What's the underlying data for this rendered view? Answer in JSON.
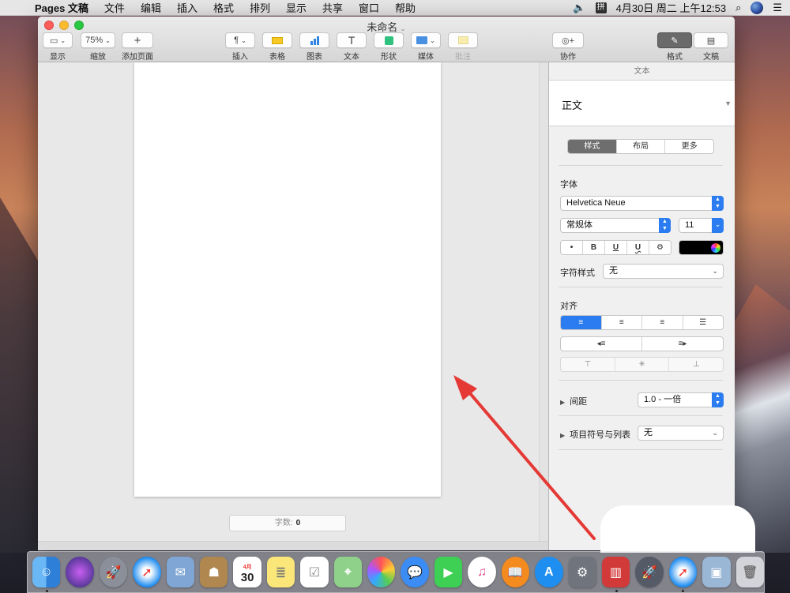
{
  "menubar": {
    "app_name": "Pages 文稿",
    "menus": [
      "文件",
      "编辑",
      "插入",
      "格式",
      "排列",
      "显示",
      "共享",
      "窗口",
      "帮助"
    ],
    "clock": "4月30日 周二 上午12:53",
    "input_method": "拼"
  },
  "window": {
    "title": "未命名",
    "toolbar": {
      "view_label": "显示",
      "zoom_value": "75%",
      "zoom_label": "缩放",
      "add_page_label": "添加页面",
      "insert_label": "插入",
      "table_label": "表格",
      "chart_label": "图表",
      "text_label": "文本",
      "shape_label": "形状",
      "media_label": "媒体",
      "comment_label": "批注",
      "collaborate_label": "协作",
      "format_label": "格式",
      "document_label": "文稿"
    }
  },
  "document": {
    "word_count_label": "字数:",
    "word_count_value": "0"
  },
  "sidebar": {
    "header": "文本",
    "paragraph_style": "正文",
    "tabs": [
      "样式",
      "布局",
      "更多"
    ],
    "font_section": "字体",
    "font_name": "Helvetica Neue",
    "font_style": "常规体",
    "font_size": "11",
    "format_buttons": [
      "•",
      "B",
      "U",
      "U",
      "⚙"
    ],
    "text_color": "#000000",
    "char_style_label": "字符样式",
    "char_style_value": "无",
    "align_section": "对齐",
    "spacing_label": "间距",
    "spacing_value": "1.0 - 一倍",
    "bullets_label": "项目符号与列表",
    "bullets_value": "无"
  },
  "dock": {
    "apps": [
      "finder",
      "siri",
      "launchpad",
      "safari",
      "mail",
      "contacts",
      "calendar",
      "notes",
      "reminders",
      "maps",
      "photos",
      "messages",
      "facetime",
      "itunes",
      "ibooks",
      "app-store",
      "system-preferences",
      "parallels",
      "rocket",
      "safari-2",
      "preview",
      "trash"
    ],
    "calendar_month": "4月",
    "calendar_day": "30"
  }
}
